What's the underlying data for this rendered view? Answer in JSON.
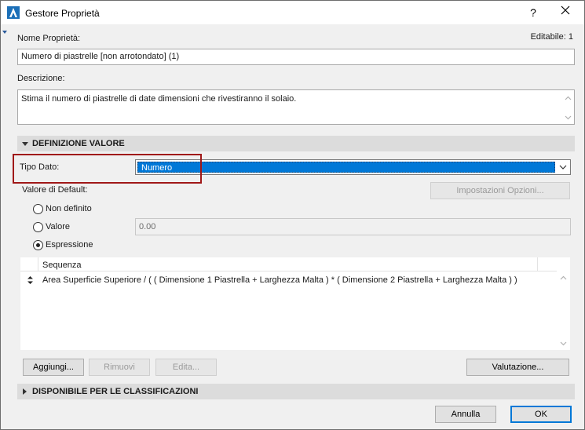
{
  "window": {
    "title": "Gestore Proprietà",
    "help_glyph": "?",
    "editable_label": "Editabile: 1"
  },
  "property_name": {
    "label": "Nome Proprietà:",
    "value": "Numero di piastrelle [non arrotondato] (1)"
  },
  "description": {
    "label": "Descrizione:",
    "value": "Stima il numero di piastrelle di date dimensioni che rivestiranno il solaio."
  },
  "value_definition": {
    "section_label": "DEFINIZIONE VALORE",
    "data_type_label": "Tipo Dato:",
    "data_type_value": "Numero",
    "default_label": "Valore di Default:",
    "options_button": "Impostazioni Opzioni...",
    "radio_options": [
      {
        "label": "Non definito",
        "checked": false
      },
      {
        "label": "Valore",
        "checked": false
      },
      {
        "label": "Espressione",
        "checked": true
      }
    ],
    "value_field": "0.00",
    "list_header": "Sequenza",
    "expression": "Area Superficie Superiore / ( ( Dimensione 1 Piastrella + Larghezza Malta ) * ( Dimensione 2 Piastrella + Larghezza Malta ) )",
    "buttons": {
      "add": "Aggiungi...",
      "remove": "Rimuovi",
      "edit": "Edita...",
      "evaluate": "Valutazione..."
    }
  },
  "classifications": {
    "section_label": "DISPONIBILE PER LE CLASSIFICAZIONI"
  },
  "footer": {
    "cancel": "Annulla",
    "ok": "OK"
  },
  "colors": {
    "accent": "#0078d7",
    "highlight_box": "#a01818",
    "section_bg": "#dcdcdc",
    "dialog_bg": "#f0f0f0"
  }
}
